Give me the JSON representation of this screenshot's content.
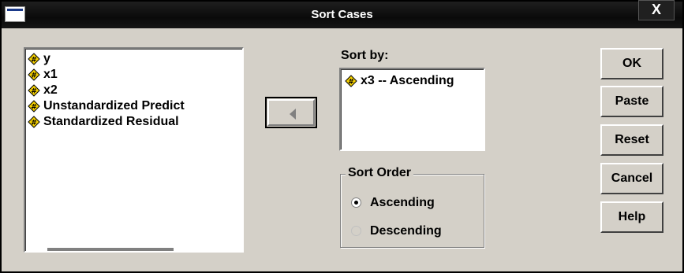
{
  "window": {
    "title": "Sort Cases",
    "close_label": "X"
  },
  "source_list": {
    "items": [
      {
        "label": "y",
        "icon": "scale-variable-icon"
      },
      {
        "label": "x1",
        "icon": "scale-variable-icon"
      },
      {
        "label": "x2",
        "icon": "scale-variable-icon"
      },
      {
        "label": "Unstandardized Predict",
        "icon": "scale-variable-icon"
      },
      {
        "label": "Standardized Residual",
        "icon": "scale-variable-icon"
      }
    ]
  },
  "move_button": {
    "icon": "left-arrow-icon"
  },
  "sort_by": {
    "label": "Sort by:",
    "items": [
      {
        "label": "x3 -- Ascending",
        "icon": "scale-variable-icon"
      }
    ]
  },
  "sort_order": {
    "legend": "Sort Order",
    "options": [
      {
        "label": "Ascending",
        "selected": true
      },
      {
        "label": "Descending",
        "selected": false
      }
    ]
  },
  "buttons": {
    "ok": "OK",
    "paste": "Paste",
    "reset": "Reset",
    "cancel": "Cancel",
    "help": "Help"
  },
  "colors": {
    "dialog_bg": "#d4d0c8",
    "title_bar": "#0a0a0a",
    "icon_yellow": "#f5d000"
  }
}
